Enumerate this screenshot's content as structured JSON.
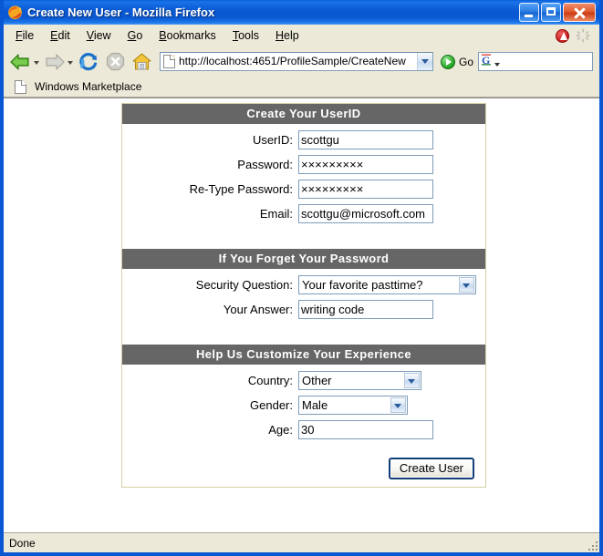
{
  "window": {
    "title": "Create New User - Mozilla Firefox",
    "app_icon": "firefox-icon",
    "buttons": {
      "minimize": "Minimize",
      "maximize": "Maximize",
      "close": "Close"
    },
    "chrome_accent": "#0a57d4",
    "titlebar_text_color": "#ffffff"
  },
  "menubar": {
    "items": [
      {
        "label": "File",
        "accesskey": "F"
      },
      {
        "label": "Edit",
        "accesskey": "E"
      },
      {
        "label": "View",
        "accesskey": "V"
      },
      {
        "label": "Go",
        "accesskey": "G"
      },
      {
        "label": "Bookmarks",
        "accesskey": "B"
      },
      {
        "label": "Tools",
        "accesskey": "T"
      },
      {
        "label": "Help",
        "accesskey": "H"
      }
    ],
    "right_icons": [
      "alert-icon",
      "throbber-icon"
    ]
  },
  "navbar": {
    "back_icon": "back-arrow-icon",
    "forward_icon": "forward-arrow-icon",
    "reload_icon": "reload-icon",
    "stop_icon": "stop-icon",
    "home_icon": "home-icon",
    "address": {
      "icon": "page-icon",
      "url": "http://localhost:4651/ProfileSample/CreateNew",
      "dropdown_icon": "chevron-down-icon"
    },
    "go": {
      "icon": "go-arrow-icon",
      "label": "Go"
    },
    "search": {
      "engine_icon": "google-g-icon",
      "engine_letter": "G",
      "value": "",
      "placeholder": ""
    }
  },
  "bookmarks": {
    "items": [
      {
        "icon": "page-icon",
        "label": "Windows Marketplace"
      }
    ]
  },
  "page": {
    "panel_border_color": "#d5cfa3",
    "header_bg": "#666666",
    "sections": [
      {
        "header": "Create Your UserID",
        "fields": [
          {
            "label": "UserID:",
            "type": "text",
            "value": "scottgu"
          },
          {
            "label": "Password:",
            "type": "password",
            "value": "×××××××××"
          },
          {
            "label": "Re-Type Password:",
            "type": "password",
            "value": "×××××××××"
          },
          {
            "label": "Email:",
            "type": "text",
            "value": "scottgu@microsoft.com"
          }
        ]
      },
      {
        "header": "If You Forget Your Password",
        "fields": [
          {
            "label": "Security Question:",
            "type": "select",
            "value": "Your favorite pasttime?"
          },
          {
            "label": "Your Answer:",
            "type": "text",
            "value": "writing code"
          }
        ]
      },
      {
        "header": "Help Us Customize Your Experience",
        "fields": [
          {
            "label": "Country:",
            "type": "select",
            "value": "Other"
          },
          {
            "label": "Gender:",
            "type": "select",
            "value": "Male"
          },
          {
            "label": "Age:",
            "type": "text",
            "value": "30"
          }
        ]
      }
    ],
    "submit_label": "Create User"
  },
  "statusbar": {
    "text": "Done"
  }
}
